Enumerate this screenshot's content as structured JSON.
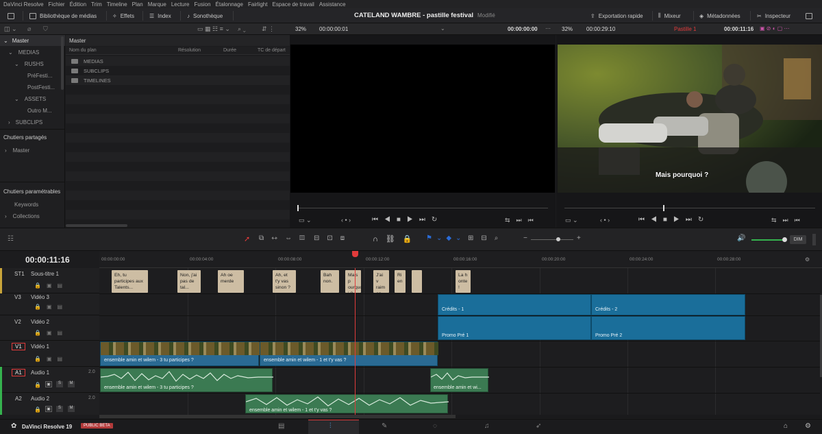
{
  "menu": [
    "DaVinci Resolve",
    "Fichier",
    "Édition",
    "Trim",
    "Timeline",
    "Plan",
    "Marque",
    "Lecture",
    "Fusion",
    "Étalonnage",
    "Fairlight",
    "Espace de travail",
    "Assistance"
  ],
  "toolbar": {
    "media_pool": "Bibliothèque de médias",
    "effects": "Effets",
    "index": "Index",
    "sound_library": "Sonothèque",
    "title": "CATELAND WAMBRE - pastille festival",
    "state": "Modifié",
    "export": "Exportation rapide",
    "mixer": "Mixeur",
    "metadata": "Métadonnées",
    "inspector": "Inspecteur"
  },
  "viewers": {
    "src_zoom": "32%",
    "src_tc": "00:00:00:01",
    "src_tc2": "00:00:00:00",
    "prog_zoom": "32%",
    "prog_dur": "00:00:29:10",
    "prog_name": "Pastille 1",
    "prog_tc": "00:00:11:16",
    "subtitle_overlay": "Mais pourquoi ?"
  },
  "bins": {
    "master": "Master",
    "medias": "MEDIAS",
    "rushs": "RUSHS",
    "pre": "PréFesti...",
    "post": "PostFesti...",
    "assets": "ASSETS",
    "outro": "Outro M...",
    "subclips": "SUBCLIPS",
    "shared": "Chutiers partagés",
    "shared_master": "Master",
    "param": "Chutiers paramétrables",
    "keywords": "Keywords",
    "collections": "Collections"
  },
  "media": {
    "header": "Master",
    "columns": [
      "Nom du plan",
      "Résolution",
      "Durée",
      "TC de départ"
    ],
    "folders": [
      "MEDIAS",
      "SUBCLIPS",
      "TIMELINES"
    ]
  },
  "timeline": {
    "timecode": "00:00:11:16",
    "ruler": [
      "00:00:00:00",
      "00:00:04:00",
      "00:00:08:00",
      "00:00:12:00",
      "00:00:16:00",
      "00:00:20:00",
      "00:00:24:00",
      "00:00:28:00"
    ],
    "dim": "DIM",
    "tracks": {
      "st1": "ST1",
      "st1_name": "Sous-titre 1",
      "v3": "V3",
      "v3_name": "Vidéo 3",
      "v2": "V2",
      "v2_name": "Vidéo 2",
      "v1": "V1",
      "v1_name": "Vidéo 1",
      "a1": "A1",
      "a1_name": "Audio 1",
      "a1_ch": "2.0",
      "a2": "A2",
      "a2_name": "Audio 2",
      "a2_ch": "2.0",
      "s": "S",
      "m": "M"
    },
    "subtitles": [
      "Eh, tu participes aux Talents...",
      "Non, j'ai pas de tal...",
      "Ah oe merde",
      "Ah, et t'y vas sinon ?",
      "Bah non.",
      "Mais p ourquo i ?",
      "J'ai v raim en...",
      "Ri en",
      "",
      "La h onte !"
    ],
    "credits1": "Crédits - 1",
    "credits2": "Crédits - 2",
    "promo1": "Promo Pré 1",
    "promo2": "Promo Pré 2",
    "v1_clip1": "ensemble amin et wilem - 3 tu participes ?",
    "v1_clip2": "ensemble amin et wilem - 1 et t'y vas ?",
    "a1_clip1": "ensemble amin et wilem - 3 tu participes ?",
    "a1_clip2": "ensemble amin et wi...",
    "a2_clip1": "ensemble amin et wilem - 1 et t'y vas ?"
  },
  "footer": {
    "app": "DaVinci Resolve 19",
    "badge": "PUBLIC BETA"
  },
  "colors": {
    "accent_red": "#e23b3b",
    "subtitle": "#cdbda3",
    "blue_clip": "#1a6e9a",
    "audio_clip": "#3b7a52"
  }
}
